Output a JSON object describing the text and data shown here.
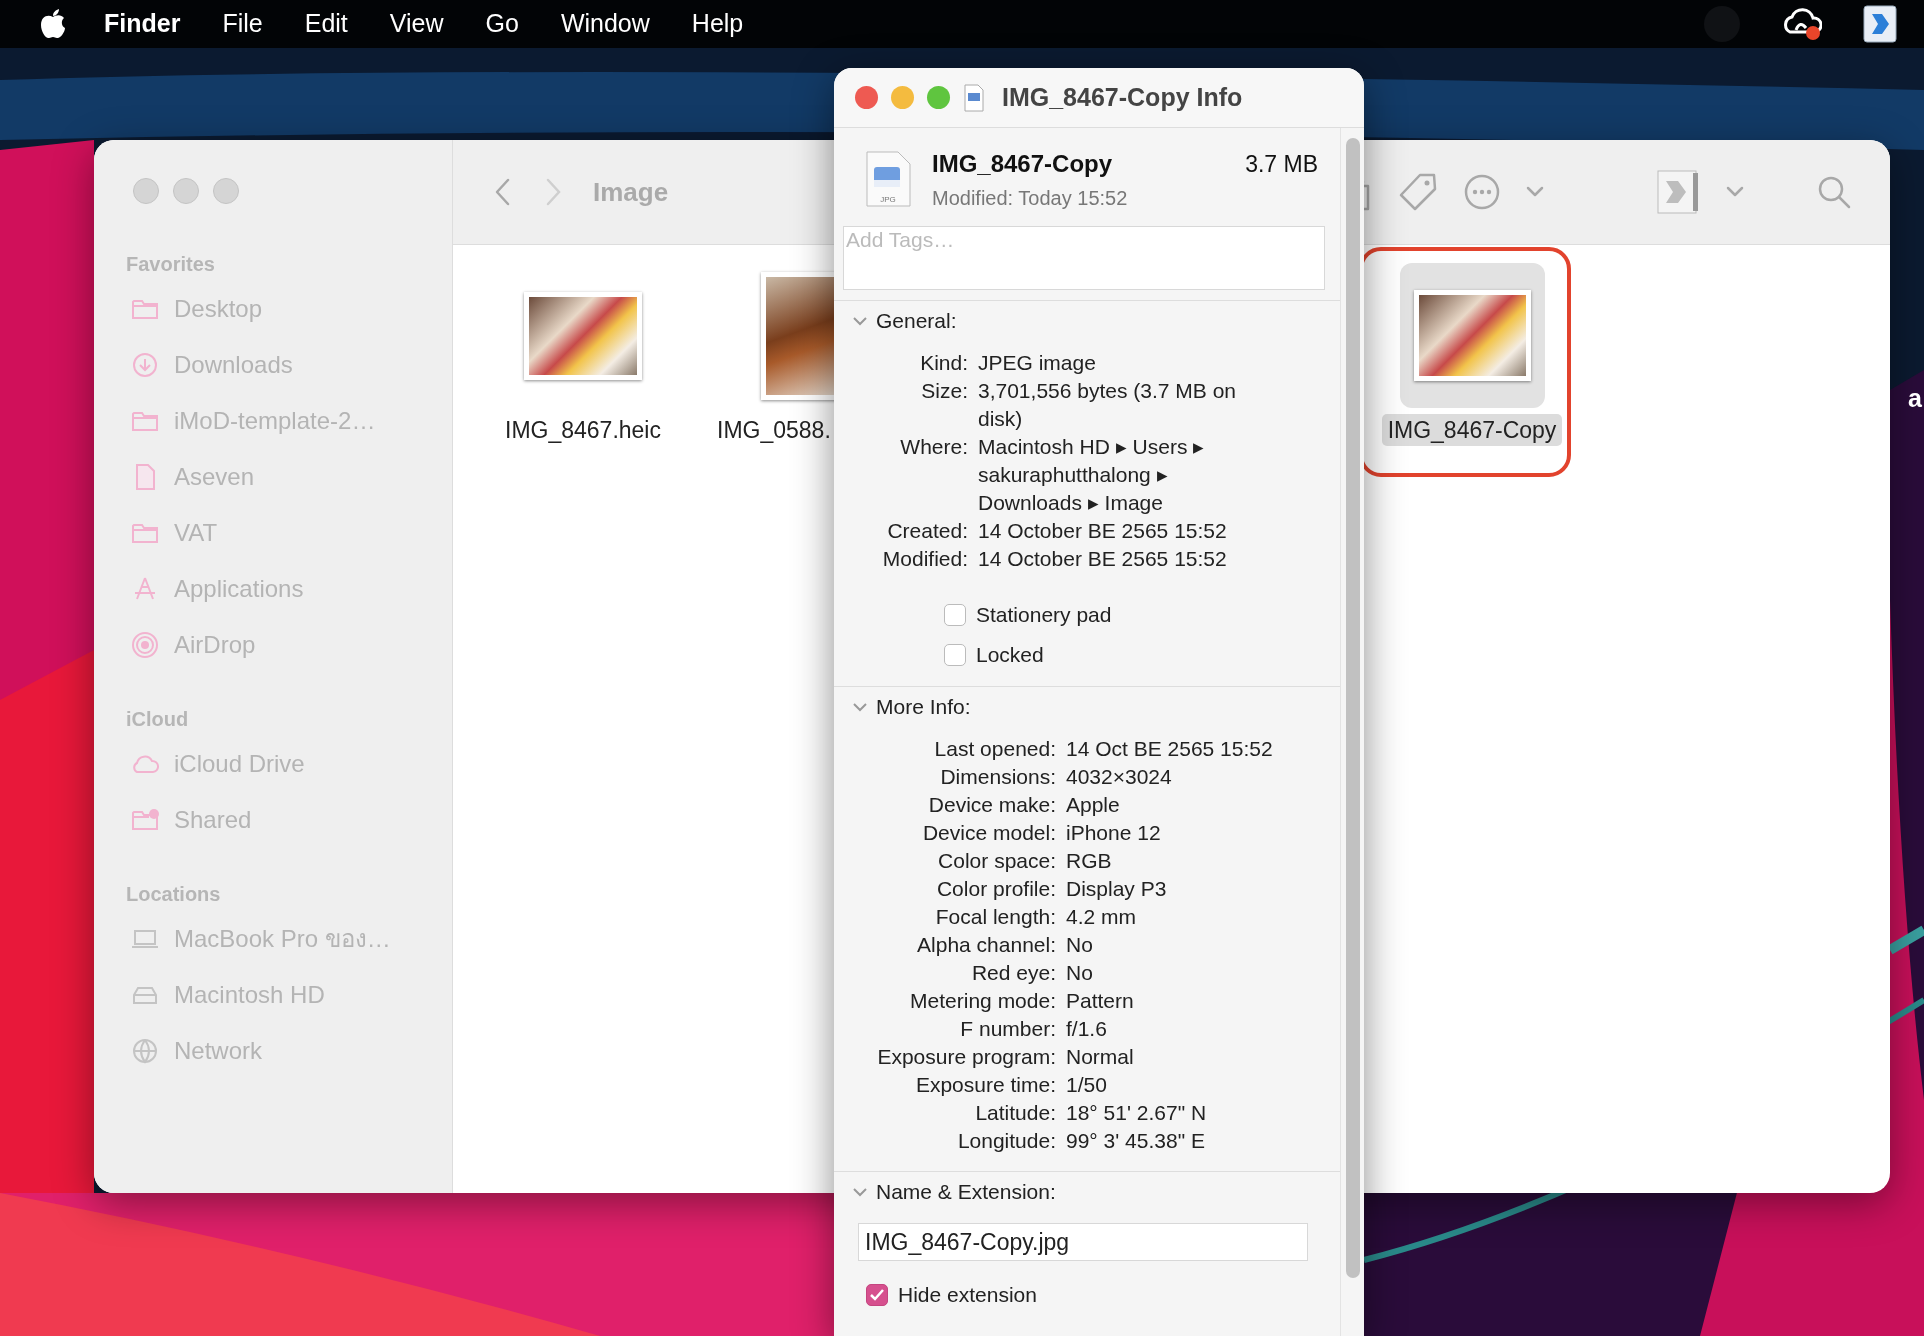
{
  "menu_bar": {
    "app": "Finder",
    "menus": [
      "File",
      "Edit",
      "View",
      "Go",
      "Window",
      "Help"
    ]
  },
  "finder": {
    "title": "Image",
    "sidebar": [
      {
        "heading": "Favorites",
        "items": [
          {
            "label": "Desktop",
            "kind": "folder"
          },
          {
            "label": "Downloads",
            "kind": "download"
          },
          {
            "label": "iMoD-template-2…",
            "kind": "folder"
          },
          {
            "label": "Aseven",
            "kind": "document"
          },
          {
            "label": "VAT",
            "kind": "folder"
          },
          {
            "label": "Applications",
            "kind": "apps"
          },
          {
            "label": "AirDrop",
            "kind": "broadcast"
          }
        ]
      },
      {
        "heading": "iCloud",
        "items": [
          {
            "label": "iCloud Drive",
            "kind": "cloud"
          },
          {
            "label": "Shared",
            "kind": "shared-folder"
          }
        ]
      },
      {
        "heading": "Locations",
        "items": [
          {
            "label": "MacBook Pro ของ…",
            "kind": "laptop"
          },
          {
            "label": "Macintosh HD",
            "kind": "disk"
          },
          {
            "label": "Network",
            "kind": "globe"
          }
        ]
      }
    ],
    "files": [
      {
        "name": "IMG_8467.heic",
        "selected": false
      },
      {
        "name": "IMG_0588.",
        "selected": false
      },
      {
        "name": "IMG_8467-Copy",
        "selected": true
      }
    ]
  },
  "info_window": {
    "title": "IMG_8467-Copy Info",
    "icon_label": "JPG",
    "file_name": "IMG_8467-Copy",
    "size": "3.7 MB",
    "modified": "Modified:  Today 15:52",
    "tags": {
      "placeholder": "Add Tags…"
    },
    "sections": [
      {
        "title": "General:",
        "expanded": true,
        "rows": [
          {
            "label": "Kind:",
            "value": "JPEG image"
          },
          {
            "label": "Size:",
            "value": "3,701,556 bytes (3.7 MB on disk)"
          },
          {
            "label": "Where:",
            "value": "Macintosh HD ▸ Users ▸ sakuraphutthalong ▸ Downloads ▸ Image"
          },
          {
            "label": "Created:",
            "value": "14 October BE 2565 15:52"
          },
          {
            "label": "Modified:",
            "value": "14 October BE 2565 15:52"
          }
        ],
        "checkboxes": [
          {
            "label": "Stationery pad",
            "checked": false
          },
          {
            "label": "Locked",
            "checked": false
          }
        ]
      },
      {
        "title": "More Info:",
        "expanded": true,
        "rows": [
          {
            "label": "Last opened:",
            "value": "14 Oct BE 2565 15:52"
          },
          {
            "label": "Dimensions:",
            "value": "4032×3024"
          },
          {
            "label": "Device make:",
            "value": "Apple"
          },
          {
            "label": "Device model:",
            "value": "iPhone 12"
          },
          {
            "label": "Color space:",
            "value": "RGB"
          },
          {
            "label": "Color profile:",
            "value": "Display P3"
          },
          {
            "label": "Focal length:",
            "value": "4.2 mm"
          },
          {
            "label": "Alpha channel:",
            "value": "No"
          },
          {
            "label": "Red eye:",
            "value": "No"
          },
          {
            "label": "Metering mode:",
            "value": "Pattern"
          },
          {
            "label": "F number:",
            "value": "f/1.6"
          },
          {
            "label": "Exposure program:",
            "value": "Normal"
          },
          {
            "label": "Exposure time:",
            "value": "1/50"
          },
          {
            "label": "Latitude:",
            "value": "18° 51' 2.67\" N"
          },
          {
            "label": "Longitude:",
            "value": "99° 3' 45.38\" E"
          }
        ]
      },
      {
        "title": "Name & Extension:",
        "expanded": true,
        "field": {
          "value": "IMG_8467-Copy.jpg"
        },
        "checkboxes": [
          {
            "label": "Hide extension",
            "checked": true
          }
        ]
      }
    ]
  },
  "desktop_text": "a"
}
